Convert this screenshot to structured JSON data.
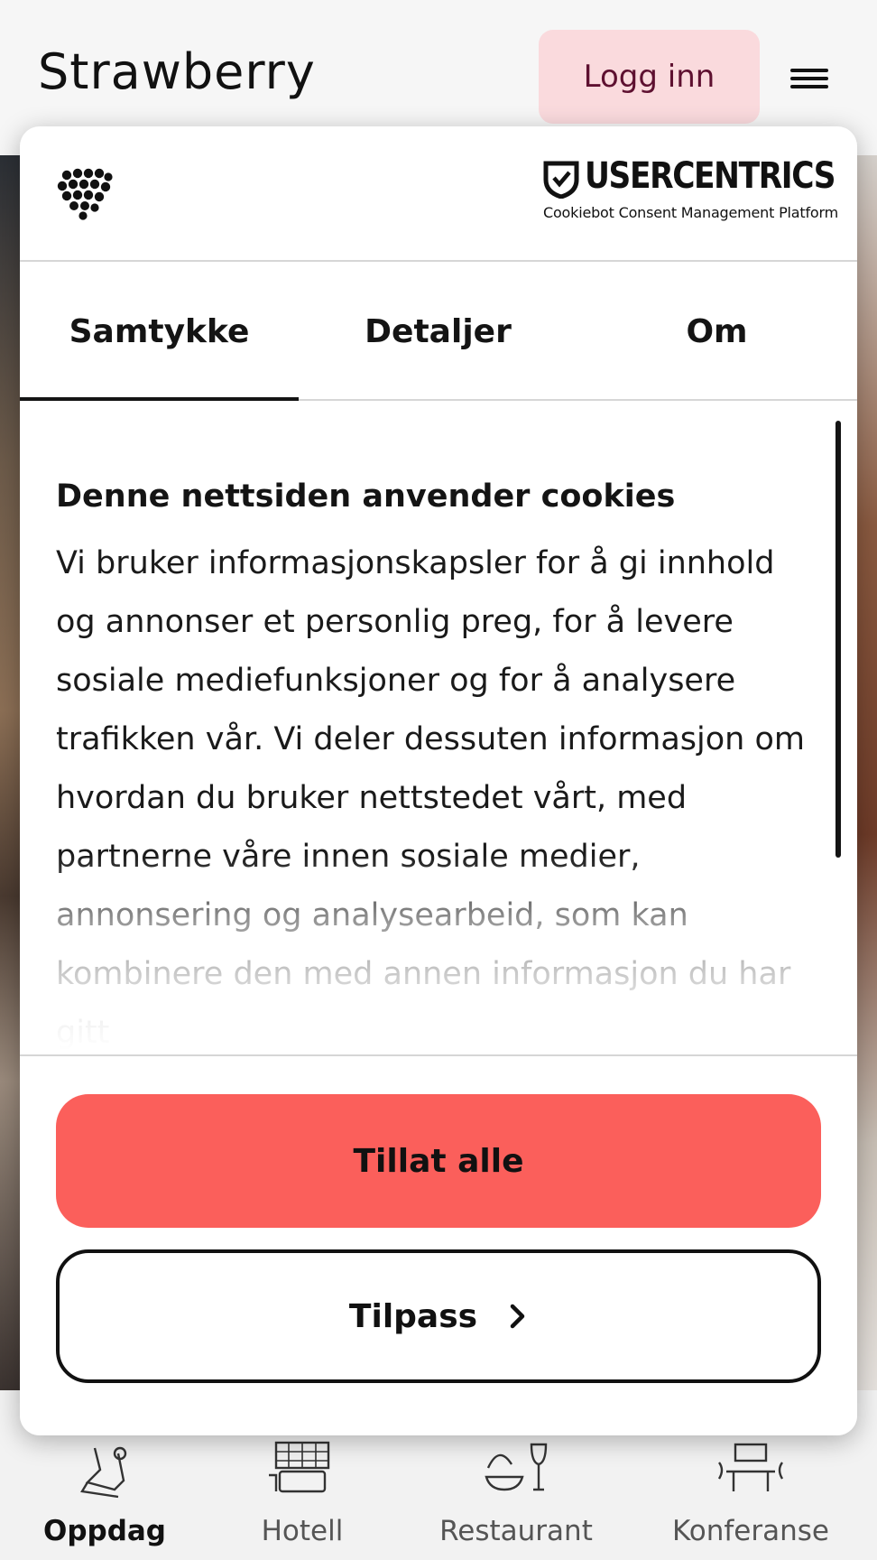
{
  "header": {
    "brand": "Strawberry",
    "login_label": "Logg inn"
  },
  "dialog": {
    "logo_left": "cookiebot-heart-logo",
    "uc_brand": "USERCENTRICS",
    "uc_subtitle": "Cookiebot Consent Management Platform",
    "tabs": [
      {
        "label": "Samtykke",
        "active": true
      },
      {
        "label": "Detaljer",
        "active": false
      },
      {
        "label": "Om",
        "active": false
      }
    ],
    "content": {
      "title": "Denne nettsiden anvender cookies",
      "body": "Vi bruker informasjonskapsler for å gi innhold og annonser et personlig preg, for å levere sosiale mediefunksjoner og for å analysere trafikken vår. Vi deler dessuten informasjon om hvordan du bruker nettstedet vårt, med partnerne våre innen sosiale medier, annonsering og analysearbeid, som kan kombinere den med annen informasjon du har gitt"
    },
    "buttons": {
      "allow_all": "Tillat alle",
      "customize": "Tilpass"
    },
    "accent_color": "#fb5f5b"
  },
  "bottom_nav": [
    {
      "label": "Oppdag",
      "icon": "discover-icon",
      "active": true
    },
    {
      "label": "Hotell",
      "icon": "hotel-icon",
      "active": false
    },
    {
      "label": "Restaurant",
      "icon": "restaurant-icon",
      "active": false
    },
    {
      "label": "Konferanse",
      "icon": "conference-icon",
      "active": false
    }
  ]
}
